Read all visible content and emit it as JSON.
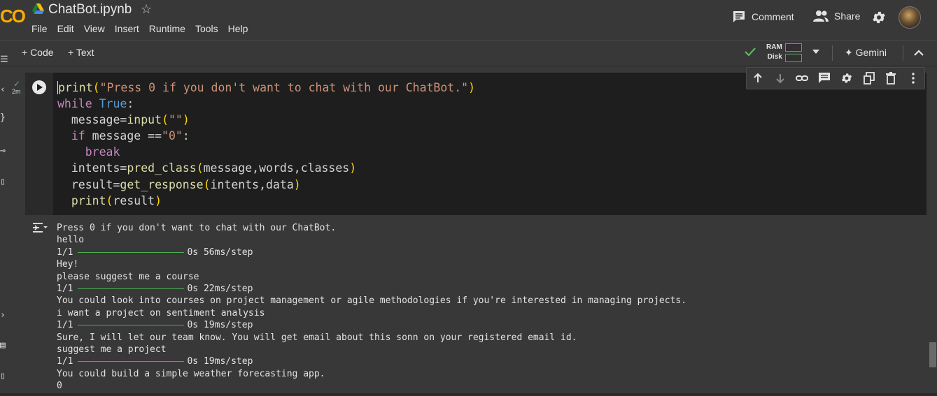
{
  "header": {
    "logo_text": "CO",
    "notebook_title": "ChatBot.ipynb",
    "star_icon": "star-icon",
    "menu": [
      "File",
      "Edit",
      "View",
      "Insert",
      "Runtime",
      "Tools",
      "Help"
    ],
    "comment_label": "Comment",
    "share_label": "Share"
  },
  "toolbar": {
    "add_code_label": "+ Code",
    "add_text_label": "+ Text",
    "ram_label": "RAM",
    "disk_label": "Disk",
    "gemini_label": "Gemini"
  },
  "cell": {
    "exec_time": "2m",
    "code_lines": [
      "print(\"Press 0 if you don't want to chat with our ChatBot.\")",
      "while True:",
      "  message=input(\"\")",
      "  if message ==\"0\":",
      "    break",
      "  intents=pred_class(message,words,classes)",
      "  result=get_response(intents,data)",
      "  print(result)"
    ],
    "toolbar_icons": [
      "move-up-icon",
      "move-down-icon",
      "link-icon",
      "comment-icon",
      "settings-icon",
      "mirror-icon",
      "delete-icon",
      "more-icon"
    ]
  },
  "output": {
    "lines": [
      "Press 0 if you don't want to chat with our ChatBot.",
      "hello",
      {
        "progress": "1/1",
        "time": "0s",
        "rate": "56ms/step"
      },
      "Hey!",
      "please suggest me a course",
      {
        "progress": "1/1",
        "time": "0s",
        "rate": "22ms/step"
      },
      "You could look into courses on project management or agile methodologies if you're interested in managing projects.",
      "i want a project on sentiment analysis",
      {
        "progress": "1/1",
        "time": "0s",
        "rate": "19ms/step"
      },
      "Sure, I will let our team know. You will get email about this sonn on your registered email id.",
      "suggest me a project",
      {
        "progress": "1/1",
        "time": "0s",
        "rate": "19ms/step"
      },
      "You could build a simple weather forecasting app.",
      "0"
    ]
  },
  "colors": {
    "background": "#383838",
    "editor_bg": "#1e1e1e",
    "accent_green": "#4caf50",
    "logo_orange": "#f9ab00"
  }
}
